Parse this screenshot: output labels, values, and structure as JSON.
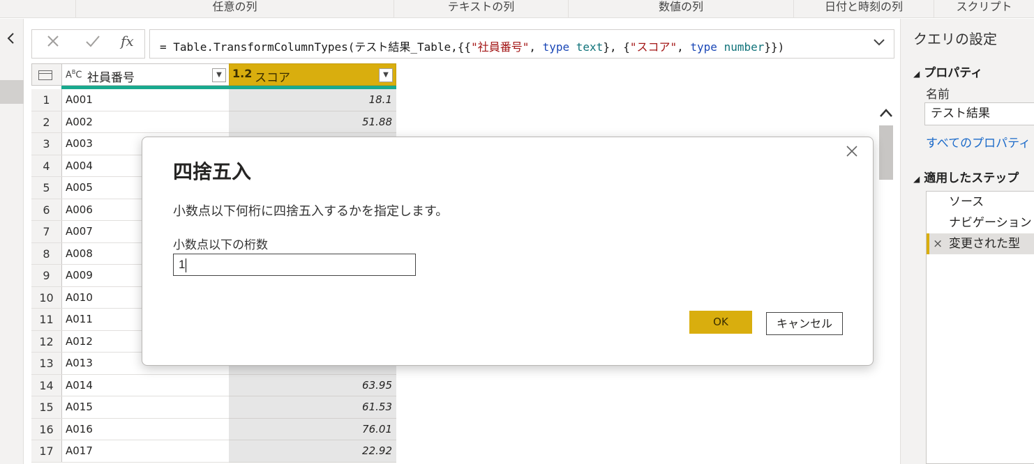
{
  "ribbon": {
    "groups": [
      "任意の列",
      "テキストの列",
      "数値の列",
      "日付と時刻の列",
      "スクリプト"
    ]
  },
  "formula": {
    "cancel_icon": "×",
    "commit_icon": "✓",
    "fx_label": "fx",
    "parts": [
      {
        "t": "= Table.TransformColumnTypes(テスト結果_Table,{{",
        "c": ""
      },
      {
        "t": "\"社員番号\"",
        "c": "str"
      },
      {
        "t": ", ",
        "c": ""
      },
      {
        "t": "type",
        "c": "kw"
      },
      {
        "t": " ",
        "c": ""
      },
      {
        "t": "text",
        "c": "ty"
      },
      {
        "t": "}, {",
        "c": ""
      },
      {
        "t": "\"スコア\"",
        "c": "str"
      },
      {
        "t": ", ",
        "c": ""
      },
      {
        "t": "type",
        "c": "kw"
      },
      {
        "t": " ",
        "c": ""
      },
      {
        "t": "number",
        "c": "ty"
      },
      {
        "t": "}})",
        "c": ""
      }
    ]
  },
  "grid": {
    "columns": [
      {
        "type_icon": "ABC",
        "name": "社員番号"
      },
      {
        "type_icon": "1.2",
        "name": "スコア"
      }
    ],
    "rows": [
      {
        "n": "1",
        "id": "A001",
        "score": "18.1"
      },
      {
        "n": "2",
        "id": "A002",
        "score": "51.88"
      },
      {
        "n": "3",
        "id": "A003",
        "score": ""
      },
      {
        "n": "4",
        "id": "A004",
        "score": ""
      },
      {
        "n": "5",
        "id": "A005",
        "score": ""
      },
      {
        "n": "6",
        "id": "A006",
        "score": ""
      },
      {
        "n": "7",
        "id": "A007",
        "score": ""
      },
      {
        "n": "8",
        "id": "A008",
        "score": ""
      },
      {
        "n": "9",
        "id": "A009",
        "score": ""
      },
      {
        "n": "10",
        "id": "A010",
        "score": ""
      },
      {
        "n": "11",
        "id": "A011",
        "score": ""
      },
      {
        "n": "12",
        "id": "A012",
        "score": ""
      },
      {
        "n": "13",
        "id": "A013",
        "score": ""
      },
      {
        "n": "14",
        "id": "A014",
        "score": "63.95"
      },
      {
        "n": "15",
        "id": "A015",
        "score": "61.53"
      },
      {
        "n": "16",
        "id": "A016",
        "score": "76.01"
      },
      {
        "n": "17",
        "id": "A017",
        "score": "22.92"
      }
    ]
  },
  "settings": {
    "title": "クエリの設定",
    "properties_header": "プロパティ",
    "name_label": "名前",
    "name_value": "テスト結果",
    "all_properties_link": "すべてのプロパティ",
    "steps_header": "適用したステップ",
    "steps": [
      "ソース",
      "ナビゲーション",
      "変更された型"
    ],
    "step_delete_icon": "×"
  },
  "dialog": {
    "title": "四捨五入",
    "description": "小数点以下何桁に四捨五入するかを指定します。",
    "field_label": "小数点以下の桁数",
    "field_value": "1",
    "ok_label": "OK",
    "cancel_label": "キャンセル",
    "close_icon": "×"
  },
  "colors": {
    "accent": "#d9ae0e",
    "quality_bar": "#19a98e",
    "link": "#1b6ac9"
  }
}
